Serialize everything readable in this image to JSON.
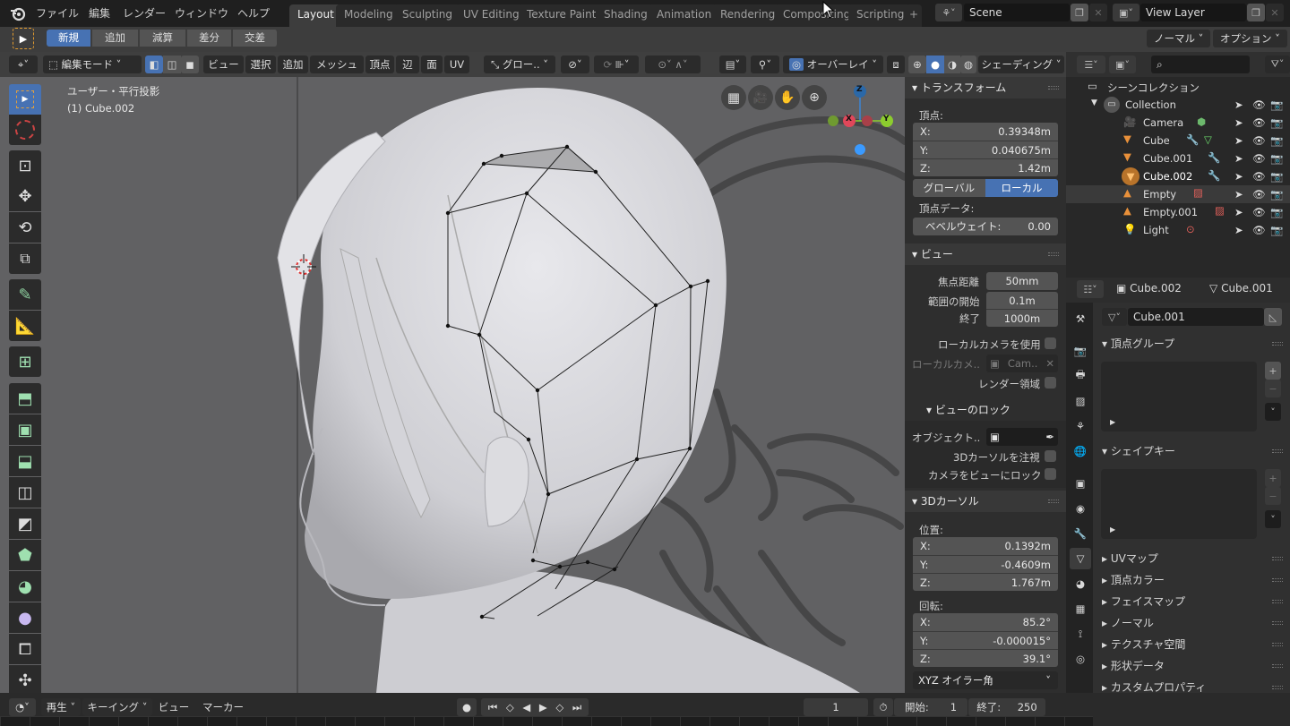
{
  "app": {
    "name": "Blender"
  },
  "menu": [
    "ファイル",
    "編集",
    "レンダー",
    "ウィンドウ",
    "ヘルプ"
  ],
  "workspaces": [
    {
      "label": "Layout",
      "active": true
    },
    {
      "label": "Modeling"
    },
    {
      "label": "Sculpting"
    },
    {
      "label": "UV Editing"
    },
    {
      "label": "Texture Paint"
    },
    {
      "label": "Shading"
    },
    {
      "label": "Animation"
    },
    {
      "label": "Rendering"
    },
    {
      "label": "Compositing"
    },
    {
      "label": "Scripting"
    }
  ],
  "add_workspace": "+",
  "scene": {
    "value": "Scene"
  },
  "view_layer": {
    "value": "View Layer"
  },
  "tool_settings": {
    "modes": [
      "新規",
      "追加",
      "減算",
      "差分",
      "交差"
    ],
    "active_mode": "新規",
    "orientation_dd": "ノーマル",
    "options_dd": "オプション"
  },
  "viewport_header": {
    "mode": "編集モード",
    "menus": [
      "ビュー",
      "選択",
      "追加",
      "メッシュ",
      "頂点",
      "辺",
      "面",
      "UV"
    ],
    "transform_orientation": "グロー..",
    "overlay": "オーバーレイ",
    "shading": "シェーディング"
  },
  "viewport": {
    "view_name": "ユーザー・平行投影",
    "object_info": "(1) Cube.002",
    "gizmo": {
      "x": "X",
      "y": "Y",
      "z": "Z"
    },
    "colors": {
      "x": "#e0475a",
      "y": "#8ccc2e",
      "z": "#3a86d4"
    }
  },
  "n_panel": {
    "transform": {
      "title": "トランスフォーム",
      "vertex_label": "頂点:",
      "x": {
        "label": "X:",
        "value": "0.39348m"
      },
      "y": {
        "label": "Y:",
        "value": "0.040675m"
      },
      "z": {
        "label": "Z:",
        "value": "1.42m"
      },
      "global": "グローバル",
      "local": "ローカル",
      "active_space": "ローカル",
      "vertex_data": "頂点データ:",
      "bevel_weight": {
        "label": "ベベルウェイト:",
        "value": "0.00"
      }
    },
    "view": {
      "title": "ビュー",
      "focal_length": {
        "label": "焦点距離",
        "value": "50mm"
      },
      "clip_start": {
        "label": "範囲の開始",
        "value": "0.1m"
      },
      "clip_end": {
        "label": "終了",
        "value": "1000m"
      },
      "use_local_camera": "ローカルカメラを使用",
      "local_camera_label": "ローカルカメ..",
      "local_camera_value": "Cam..",
      "render_region": "レンダー領域"
    },
    "view_lock": {
      "title": "ビューのロック",
      "object_label": "オブジェクト..",
      "lock_to_cursor": "3Dカーソルを注視",
      "lock_camera": "カメラをビューにロック"
    },
    "cursor": {
      "title": "3Dカーソル",
      "location_label": "位置:",
      "x": {
        "label": "X:",
        "value": "0.1392m"
      },
      "y": {
        "label": "Y:",
        "value": "-0.4609m"
      },
      "z": {
        "label": "Z:",
        "value": "1.767m"
      },
      "rotation_label": "回転:",
      "rx": {
        "label": "X:",
        "value": "85.2°"
      },
      "ry": {
        "label": "Y:",
        "value": "-0.000015°"
      },
      "rz": {
        "label": "Z:",
        "value": "39.1°"
      },
      "rotation_mode": "XYZ オイラー角"
    }
  },
  "outliner": {
    "search_placeholder": "",
    "scene_collection": "シーンコレクション",
    "collection": "Collection",
    "items": [
      {
        "name": "Camera",
        "type": "camera"
      },
      {
        "name": "Cube",
        "type": "mesh"
      },
      {
        "name": "Cube.001",
        "type": "mesh"
      },
      {
        "name": "Cube.002",
        "type": "mesh",
        "active": true
      },
      {
        "name": "Empty",
        "type": "empty",
        "highlighted": true
      },
      {
        "name": "Empty.001",
        "type": "empty"
      },
      {
        "name": "Light",
        "type": "light"
      }
    ]
  },
  "properties": {
    "breadcrumb_object": "Cube.002",
    "breadcrumb_data": "Cube.001",
    "data_name": "Cube.001",
    "sections": {
      "vertex_groups": "頂点グループ",
      "shape_keys": "シェイプキー",
      "collapsed": [
        "UVマップ",
        "頂点カラー",
        "フェイスマップ",
        "ノーマル",
        "テクスチャ空間",
        "形状データ",
        "カスタムプロパティ"
      ]
    }
  },
  "timeline": {
    "menus": [
      "再生",
      "キーイング",
      "ビュー",
      "マーカー"
    ],
    "current_frame": "1",
    "start_label": "開始:",
    "start": "1",
    "end_label": "終了:",
    "end": "250"
  }
}
